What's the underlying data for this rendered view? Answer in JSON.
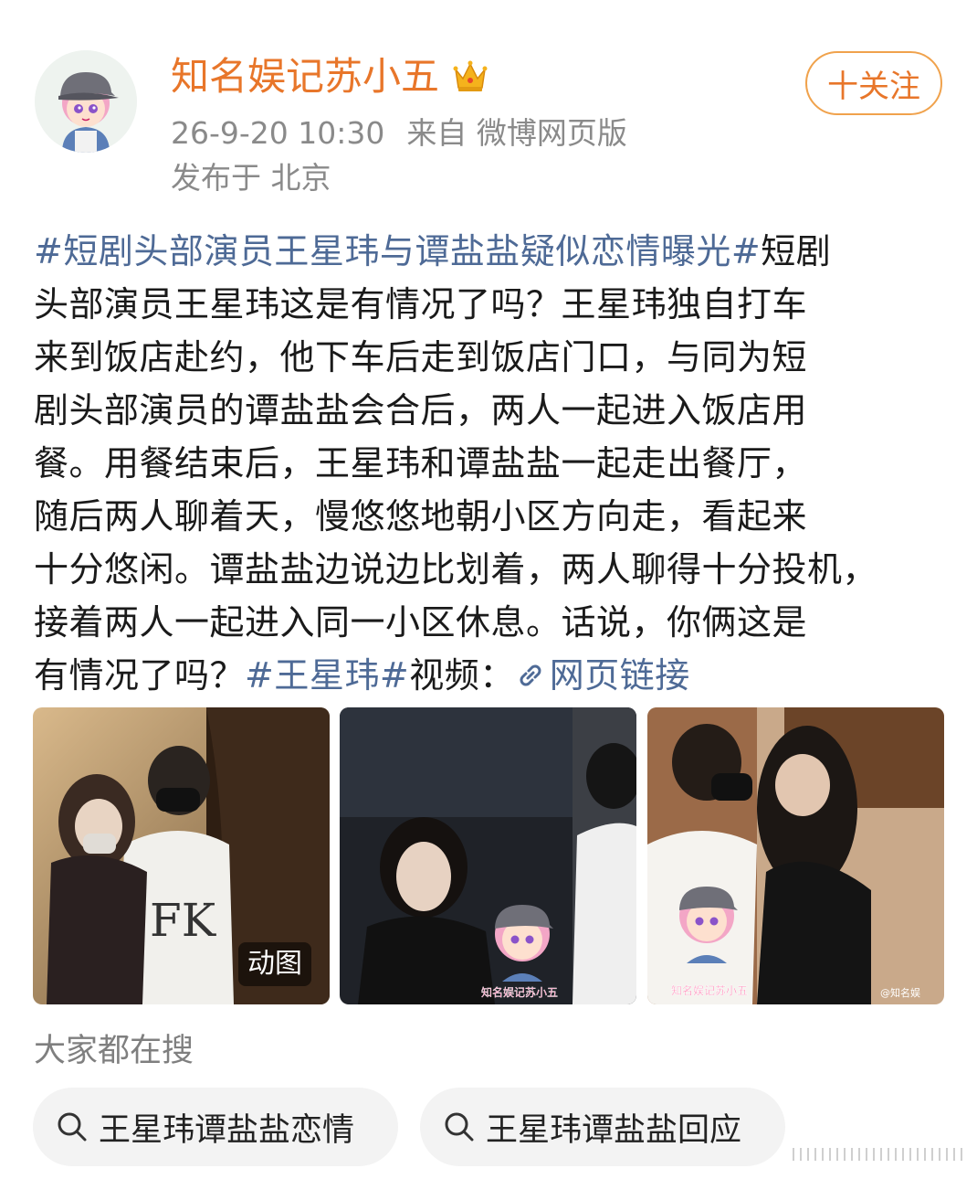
{
  "header": {
    "username": "知名娱记苏小五",
    "timestamp": "26-9-20 10:30",
    "source": "来自 微博网页版",
    "location": "发布于 北京",
    "follow_label": "十关注",
    "badge_icon": "crown-icon"
  },
  "post": {
    "lines": [
      [
        {
          "t": "#短剧头部演员王星玮与谭盐盐疑似恋情曝光#",
          "k": "topic"
        },
        {
          "t": "短剧",
          "k": "text"
        }
      ],
      [
        {
          "t": "头部演员王星玮这是有情况了吗？王星玮独自打车",
          "k": "text"
        }
      ],
      [
        {
          "t": "来到饭店赴约，他下车后走到饭店门口，与同为短",
          "k": "text"
        }
      ],
      [
        {
          "t": "剧头部演员的谭盐盐会合后，两人一起进入饭店用",
          "k": "text"
        }
      ],
      [
        {
          "t": "餐。用餐结束后，王星玮和谭盐盐一起走出餐厅，",
          "k": "text"
        }
      ],
      [
        {
          "t": "随后两人聊着天，慢悠悠地朝小区方向走，看起来",
          "k": "text"
        }
      ],
      [
        {
          "t": "十分悠闲。谭盐盐边说边比划着，两人聊得十分投机，",
          "k": "text"
        }
      ],
      [
        {
          "t": "接着两人一起进入同一小区休息。话说，你俩这是",
          "k": "text"
        }
      ],
      [
        {
          "t": "有情况了吗？",
          "k": "text"
        },
        {
          "t": "#王星玮#",
          "k": "topic"
        },
        {
          "t": "视频：",
          "k": "text"
        },
        {
          "t": "网页链接",
          "k": "link"
        }
      ]
    ]
  },
  "photos": {
    "gif_label": "动图",
    "watermark_text": "知名娱记苏小五",
    "weibo_watermark": "@知名娱"
  },
  "search": {
    "title": "大家都在搜",
    "chips": [
      "王星玮谭盐盐恋情",
      "王星玮谭盐盐回应"
    ]
  },
  "colors": {
    "username": "#e8762a",
    "topic": "#4e6a96",
    "meta": "#8a8a8a"
  }
}
